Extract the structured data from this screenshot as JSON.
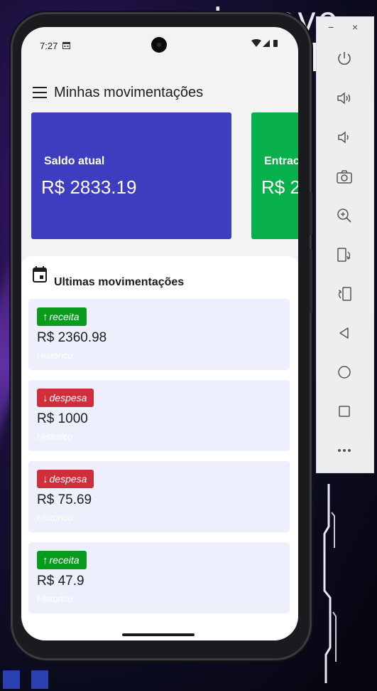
{
  "background": {
    "logo_text": "Lenovo"
  },
  "status_bar": {
    "time": "7:27",
    "calendar_icon": "calendar-small-icon",
    "system_icons": "▾◢▮"
  },
  "app_bar": {
    "menu_icon": "hamburger-menu-icon",
    "title": "Minhas movimentações"
  },
  "summary_cards": [
    {
      "label": "Saldo atual",
      "value": "R$ 2833.19",
      "color": "#3e3cbf"
    },
    {
      "label": "Entrac",
      "value": "R$ 2",
      "color": "#07b04a"
    }
  ],
  "list": {
    "icon": "calendar-icon",
    "title": "Ultimas movimentações",
    "items": [
      {
        "type": "receita",
        "arrow": "↑",
        "value": "R$ 2360.98",
        "history": "Historico",
        "badge_color": "#0a9a1e"
      },
      {
        "type": "despesa",
        "arrow": "↓",
        "value": "R$ 1000",
        "history": "Historico",
        "badge_color": "#cf2e3b"
      },
      {
        "type": "despesa",
        "arrow": "↓",
        "value": "R$ 75.69",
        "history": "Historico",
        "badge_color": "#cf2e3b"
      },
      {
        "type": "receita",
        "arrow": "↑",
        "value": "R$ 47.9",
        "history": "Historico",
        "badge_color": "#0a9a1e"
      }
    ]
  },
  "emulator_toolbar": {
    "minimize": "−",
    "close": "×",
    "buttons": [
      "power-icon",
      "volume-up-icon",
      "volume-down-icon",
      "camera-icon",
      "zoom-in-icon",
      "rotate-left-icon",
      "rotate-right-icon",
      "back-icon",
      "home-icon",
      "overview-icon",
      "more-icon"
    ]
  }
}
